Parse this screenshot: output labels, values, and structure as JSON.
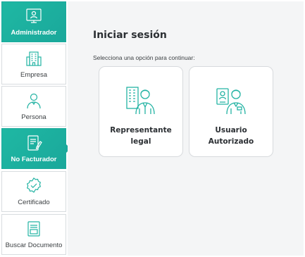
{
  "sidebar": {
    "items": [
      {
        "label": "Administrador",
        "icon": "admin-icon",
        "active": true
      },
      {
        "label": "Empresa",
        "icon": "building-icon",
        "active": false
      },
      {
        "label": "Persona",
        "icon": "person-icon",
        "active": false
      },
      {
        "label": "No Facturador",
        "icon": "document-edit-icon",
        "active": true
      },
      {
        "label": "Certificado",
        "icon": "certificate-badge-icon",
        "active": false
      },
      {
        "label": "Buscar Documento",
        "icon": "document-search-icon",
        "active": false
      }
    ]
  },
  "main": {
    "title": "Iniciar sesión",
    "subtitle": "Selecciona una opción para continuar:",
    "options": [
      {
        "line1": "Representante",
        "line2": "legal",
        "icon": "legal-representative-icon"
      },
      {
        "line1": "Usuario",
        "line2": "Autorizado",
        "icon": "authorized-user-icon"
      }
    ]
  },
  "colors": {
    "accent": "#1aa89b",
    "icon_stroke": "#23b3a3",
    "background": "#f4f5f6"
  }
}
